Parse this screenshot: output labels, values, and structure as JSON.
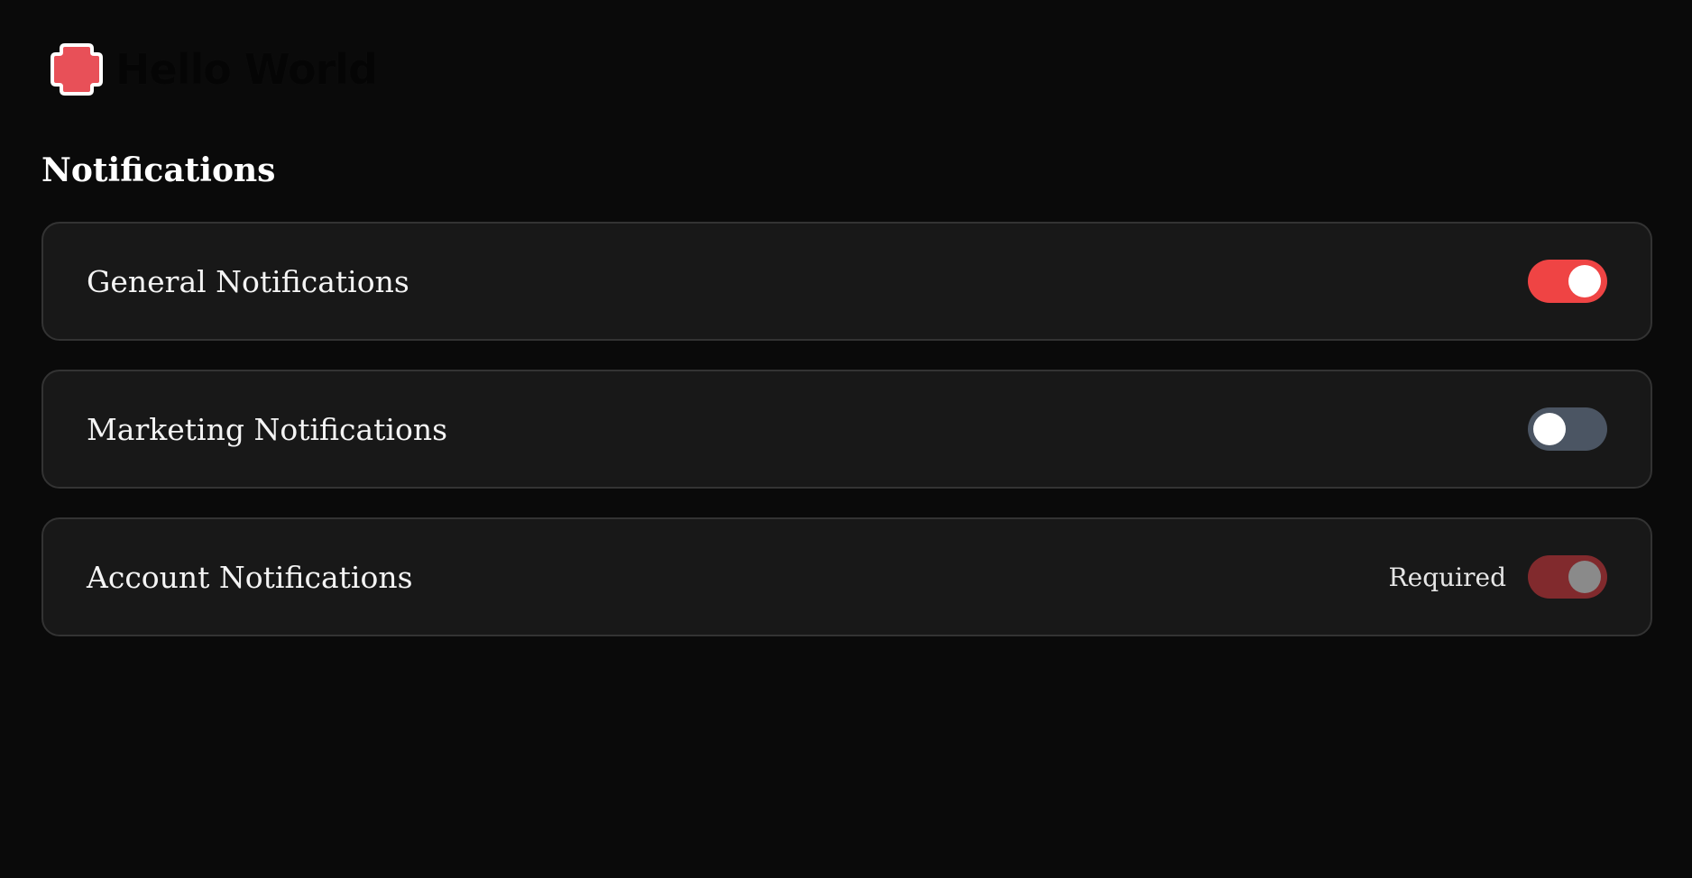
{
  "header": {
    "brand_name": "Hello World",
    "logo_icon": "red-cross-blob-icon",
    "brand_color": "#ef4444"
  },
  "section": {
    "title": "Notifications"
  },
  "notifications": [
    {
      "label": "General Notifications",
      "state": "on",
      "toggle_color": "#ef4444"
    },
    {
      "label": "Marketing Notifications",
      "state": "off",
      "toggle_color": "#4b5563"
    },
    {
      "label": "Account Notifications",
      "state": "on-locked",
      "required_label": "Required",
      "toggle_color": "#812a2d"
    }
  ]
}
